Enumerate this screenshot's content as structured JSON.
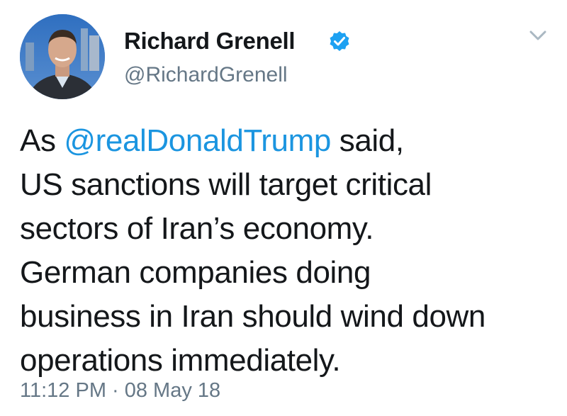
{
  "user": {
    "display_name": "Richard Grenell",
    "handle": "@RichardGrenell",
    "verified": true,
    "avatar_icon": "profile-photo"
  },
  "tweet": {
    "lines": [
      {
        "prefix": "As ",
        "mention": "@realDonaldTrump",
        "suffix": " said,"
      },
      {
        "text": "US sanctions will target critical"
      },
      {
        "text": "sectors of Iran’s economy."
      },
      {
        "text": "German companies doing"
      },
      {
        "text": "business in Iran should wind down"
      },
      {
        "text": "operations immediately."
      }
    ],
    "timestamp": "11:12 PM · 08 May 18"
  },
  "icons": {
    "verified": "verified-badge-icon",
    "caret": "chevron-down-icon"
  },
  "colors": {
    "text": "#14171a",
    "secondary": "#657786",
    "link": "#1b95e0",
    "verified": "#1da1f2"
  }
}
